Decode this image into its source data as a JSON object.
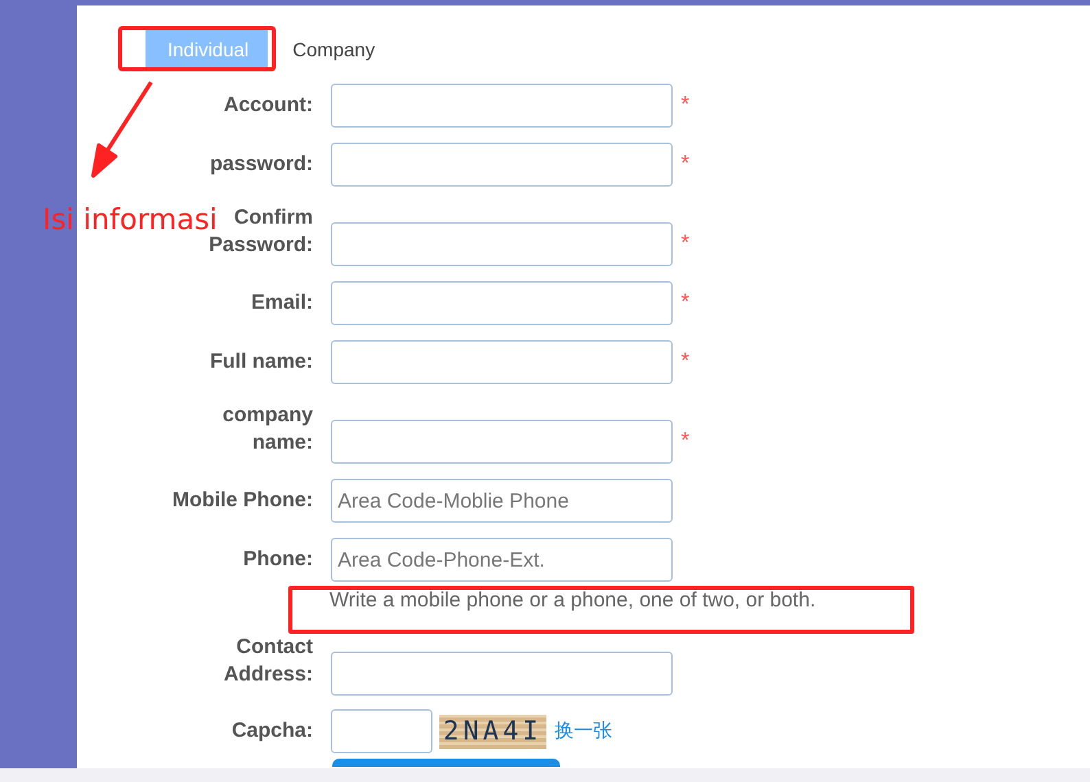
{
  "tabs": [
    {
      "label": "Individual",
      "selected": true
    },
    {
      "label": "Company",
      "selected": false
    }
  ],
  "fields": [
    {
      "label": "Account:",
      "required": true
    },
    {
      "label": "password:",
      "required": true
    },
    {
      "label": "Confirm\nPassword:",
      "required": true
    },
    {
      "label": "Email:",
      "required": true
    },
    {
      "label": "Full name:",
      "required": true
    },
    {
      "label": "company\nname:",
      "required": true
    },
    {
      "label": "Mobile Phone:",
      "required": false,
      "placeholder": "Area Code-Moblie Phone"
    },
    {
      "label": "Phone:",
      "required": false,
      "placeholder": "Area Code-Phone-Ext."
    }
  ],
  "phone_hint": "Write a mobile phone or a phone, one of two, or both.",
  "address": {
    "label": "Contact\nAddress:"
  },
  "captcha": {
    "label": "Capcha:",
    "code": "2NA4I",
    "refresh_link": "换一张"
  },
  "annotation": {
    "text": "Isi informasi",
    "marker": "*"
  }
}
